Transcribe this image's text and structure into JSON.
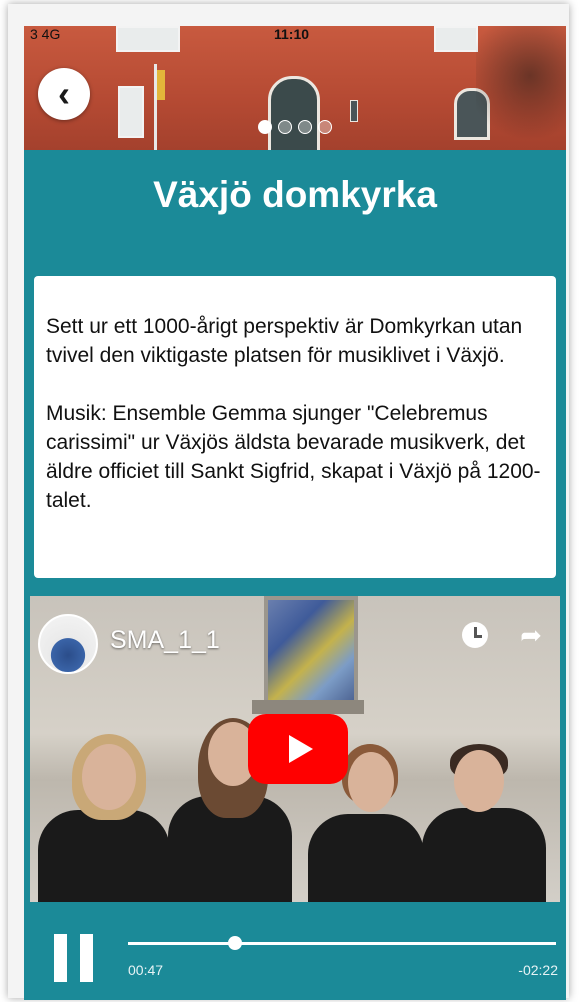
{
  "status_bar": {
    "carrier": "3  4G",
    "time": "11:10"
  },
  "header": {
    "back_icon": "chevron-left-icon",
    "carousel": {
      "total": 4,
      "active_index": 0
    }
  },
  "title": "Växjö domkyrka",
  "description": {
    "paragraph1": "Sett ur ett 1000-årigt perspektiv är Domkyrkan utan tvivel den viktigaste platsen för musiklivet i Växjö.",
    "paragraph2": "Musik: Ensemble Gemma sjunger \"Celebremus carissimi\" ur Växjös äldsta bevarade musikverk, det äldre officiet till Sankt Sigfrid, skapat i Växjö på 1200-talet."
  },
  "video": {
    "title": "SMA_1_1",
    "icons": [
      "clock-icon",
      "share-icon",
      "play-icon"
    ]
  },
  "player": {
    "current_time": "00:47",
    "remaining_time": "-02:22",
    "progress": 0.25
  },
  "colors": {
    "primary": "#1b8a98",
    "play_button": "#ff0000"
  }
}
